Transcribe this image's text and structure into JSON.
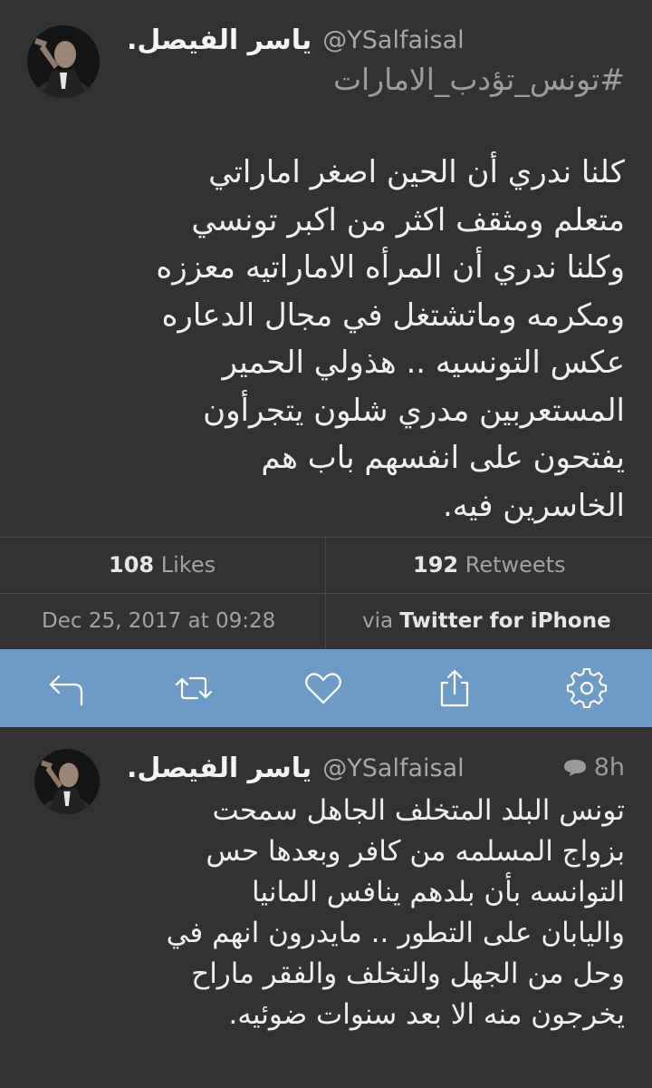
{
  "main_tweet": {
    "display_name": "ياسر الفيصل.",
    "handle": "@YSalfaisal",
    "hashtag": "#تونس_تؤدب_الامارات",
    "text_lines": [
      "كلنا ندري أن الحين اصغر اماراتي",
      "متعلم ومثقف اكثر من اكبر تونسي",
      "وكلنا ندري أن المرأه الاماراتيه معززه",
      "ومكرمه وماتشتغل في مجال الدعاره",
      "عكس التونسيه .. هذولي الحمير",
      "المستعربين مدري شلون يتجرأون",
      "يفتحون على انفسهم باب هم",
      "الخاسرين فيه."
    ],
    "likes_count": "108",
    "likes_label": "Likes",
    "retweets_count": "192",
    "retweets_label": "Retweets",
    "date": "Dec 25, 2017 at 09:28",
    "via_prefix": "via",
    "via_app": "Twitter for iPhone"
  },
  "actions": {
    "icons": [
      "reply-icon",
      "retweet-icon",
      "heart-icon",
      "share-icon",
      "gear-icon"
    ],
    "bar_color": "#6e9bc6"
  },
  "second_tweet": {
    "display_name": "ياسر الفيصل.",
    "handle": "@YSalfaisal",
    "time": "8h",
    "text_lines": [
      "تونس البلد المتخلف الجاهل سمحت",
      "بزواج المسلمه من كافر وبعدها حس",
      "التوانسه بأن بلدهم ينافس المانيا",
      "واليابان على التطور .. مايدرون انهم في",
      "وحل من الجهل والتخلف والفقر ماراح",
      "يخرجون منه الا بعد سنوات ضوئيه."
    ]
  }
}
